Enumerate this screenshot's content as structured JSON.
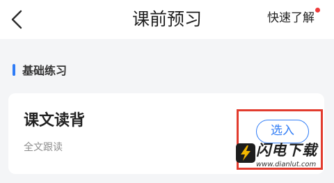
{
  "header": {
    "back_icon": "chevron-left-icon",
    "title": "课前预习",
    "quick_link": "快速了解",
    "notification_dot_color": "#ee3b3b"
  },
  "section": {
    "title": "基础练习",
    "accent_color": "#2f7cf6"
  },
  "card": {
    "title": "课文读背",
    "subtitle": "全文跟读",
    "select_label": "选入"
  },
  "watermark": {
    "brand": "闪电下载",
    "url": "www.dianlut.com"
  },
  "colors": {
    "background": "#f4f5f7",
    "highlight": "#e23b2e",
    "primary": "#2f7cf6"
  }
}
